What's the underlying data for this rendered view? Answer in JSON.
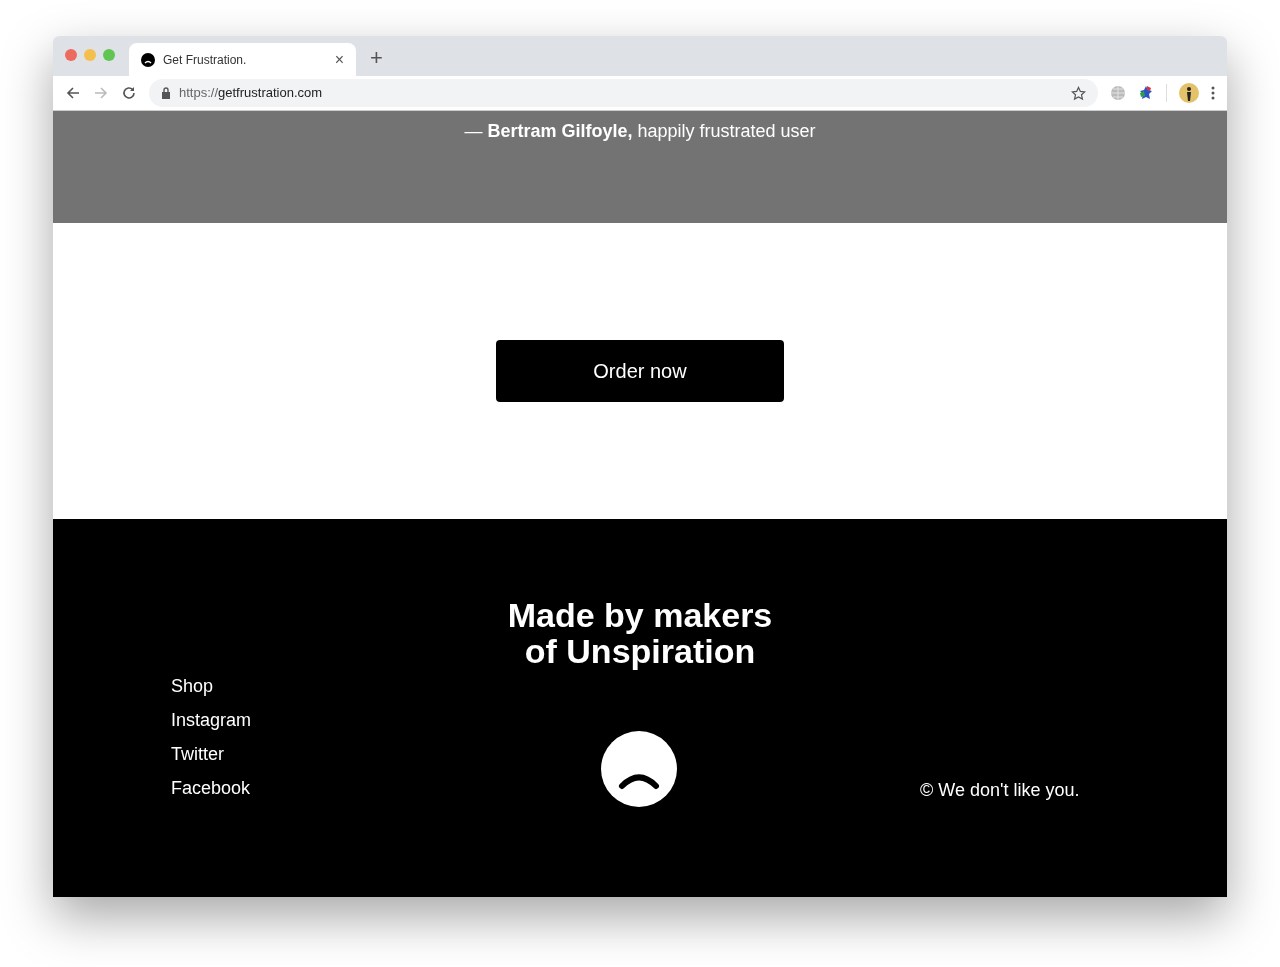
{
  "browser": {
    "tab_title": "Get Frustration.",
    "tab_close": "×",
    "new_tab": "+",
    "url_scheme": "https://",
    "url_host": "getfrustration.com"
  },
  "testimonial": {
    "attribution": "— **Bertram Gilfoyle,** happily frustrated user"
  },
  "cta": {
    "button": "Order now"
  },
  "footer": {
    "heading_lines": [
      "Made by makers",
      "of Unspiration"
    ],
    "links": [
      "Shop",
      "Instagram",
      "Twitter",
      "Facebook"
    ],
    "copyright": "© We don't like you."
  }
}
